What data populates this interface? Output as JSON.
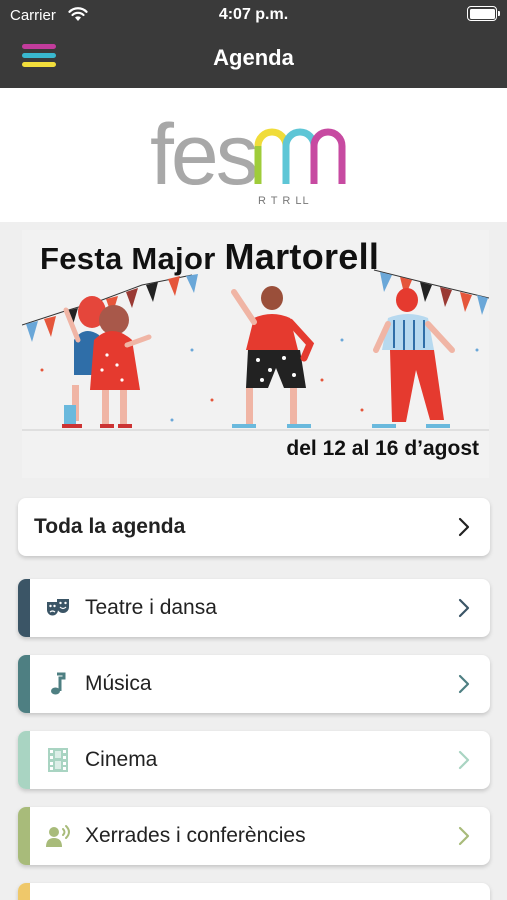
{
  "status_bar": {
    "carrier": "Carrier",
    "time": "4:07 p.m."
  },
  "nav": {
    "title": "Agenda"
  },
  "logo": {
    "text": "fesmm",
    "subtitle": "R T R LL"
  },
  "banner": {
    "title_part1": "Festa Major",
    "title_part2": "Martorell",
    "dates": "del 12 al 16 d’agost"
  },
  "menu": {
    "all_label": "Toda la agenda",
    "categories": [
      {
        "label": "Teatre i dansa",
        "icon": "theater-masks-icon",
        "color": "#3b5566"
      },
      {
        "label": "Música",
        "icon": "music-note-icon",
        "color": "#4e7f82"
      },
      {
        "label": "Cinema",
        "icon": "film-strip-icon",
        "color": "#a9d4c2"
      },
      {
        "label": "Xerrades i conferències",
        "icon": "speaker-icon",
        "color": "#a8bb7a"
      },
      {
        "label": "",
        "icon": "",
        "color": "#efc86a"
      }
    ]
  }
}
